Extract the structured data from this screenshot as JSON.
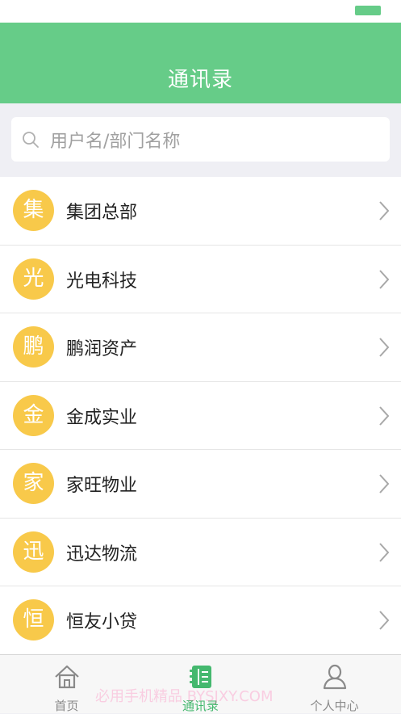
{
  "nav": {
    "title": "通讯录"
  },
  "search": {
    "placeholder": "用户名/部门名称"
  },
  "contacts": [
    {
      "avatar": "集",
      "name": "集团总部"
    },
    {
      "avatar": "光",
      "name": "光电科技"
    },
    {
      "avatar": "鹏",
      "name": "鹏润资产"
    },
    {
      "avatar": "金",
      "name": "金成实业"
    },
    {
      "avatar": "家",
      "name": "家旺物业"
    },
    {
      "avatar": "迅",
      "name": "迅达物流"
    },
    {
      "avatar": "恒",
      "name": "恒友小贷"
    }
  ],
  "tabs": [
    {
      "label": "首页",
      "icon": "home-icon"
    },
    {
      "label": "通讯录",
      "icon": "contacts-book-icon",
      "active": true
    },
    {
      "label": "个人中心",
      "icon": "user-icon"
    }
  ],
  "watermark": "必用手机精品 BYSJXY.COM",
  "colors": {
    "accent": "#66cc88",
    "avatar": "#f8c94a",
    "active_tab": "#44b86e"
  }
}
